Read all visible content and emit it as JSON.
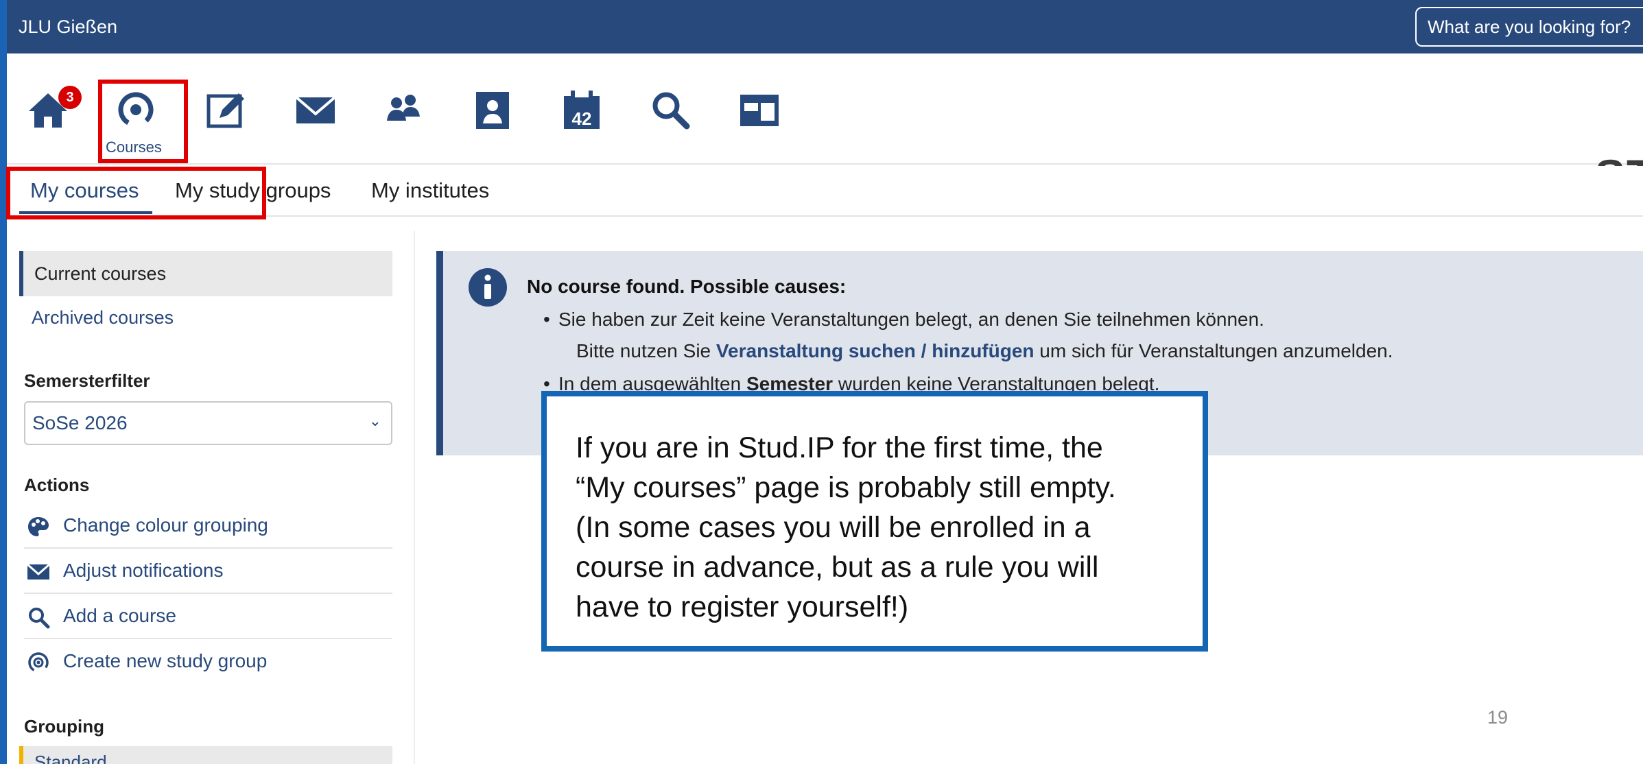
{
  "topbar": {
    "brand": "JLU Gießen",
    "search_placeholder": "What are you looking for?"
  },
  "nav": {
    "home_badge": "3",
    "courses_label": "Courses",
    "calendar_day": "42",
    "logo_text": "ST"
  },
  "tabs": [
    {
      "label": "My courses"
    },
    {
      "label": "My study groups"
    },
    {
      "label": "My institutes"
    }
  ],
  "sidebar": {
    "views": [
      "Current courses",
      "Archived courses"
    ],
    "semester_heading": "Semersterfilter",
    "semester_value": "SoSe 2026",
    "actions_heading": "Actions",
    "actions": [
      {
        "label": "Change colour grouping",
        "icon": "palette-icon"
      },
      {
        "label": "Adjust notifications",
        "icon": "envelope-icon"
      },
      {
        "label": "Add a course",
        "icon": "search-icon"
      },
      {
        "label": "Create new study group",
        "icon": "study-group-icon"
      }
    ],
    "grouping_heading": "Grouping",
    "grouping_item": "Standard"
  },
  "info": {
    "title": "No course found. Possible causes:",
    "bullet1": "Sie haben zur Zeit keine Veranstaltungen belegt, an denen Sie teilnehmen können.",
    "line2_prefix": "Bitte nutzen Sie ",
    "line2_link": "Veranstaltung suchen / hinzufügen",
    "line2_suffix": " um sich für Veranstaltungen anzumelden.",
    "bullet2_prefix": "In dem ausgewählten ",
    "bullet2_bold": "Semester",
    "bullet2_suffix": " wurden keine Veranstaltungen belegt."
  },
  "callout": {
    "lines": [
      "If you are in Stud.IP for the first time, the",
      "“My courses” page is probably still empty.",
      "(In some cases you will be enrolled in a",
      "course in advance, but as a rule you will",
      "have to register yourself!)"
    ]
  },
  "slide_number": "19",
  "colors": {
    "header": "#28497c",
    "accent_red": "#e00000",
    "callout_border": "#1565b5",
    "info_bg": "#dfe3ec"
  }
}
